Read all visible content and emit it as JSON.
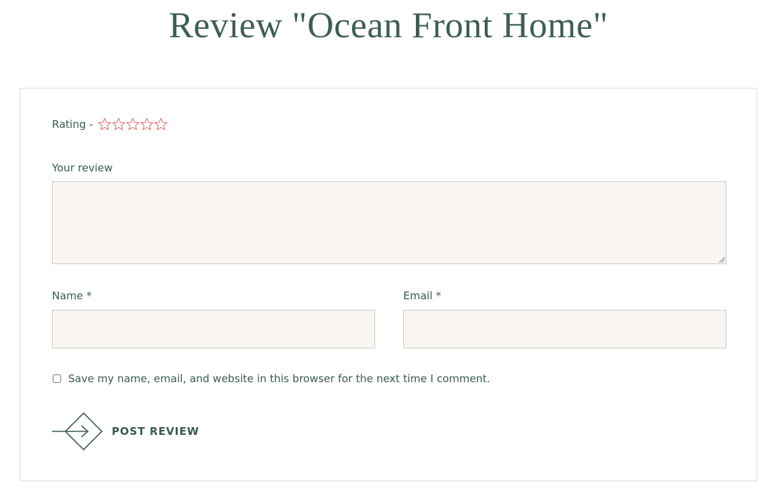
{
  "page": {
    "title": "Review \"Ocean Front Home\""
  },
  "rating": {
    "label": "Rating -",
    "max_stars": 5,
    "selected": 0,
    "star_color": "#e57373"
  },
  "review_field": {
    "label": "Your review",
    "value": ""
  },
  "name_field": {
    "label": "Name *",
    "value": ""
  },
  "email_field": {
    "label": "Email *",
    "value": ""
  },
  "save_info": {
    "label": "Save my name, email, and website in this browser for the next time I comment.",
    "checked": false
  },
  "submit": {
    "label": "POST REVIEW"
  },
  "colors": {
    "text": "#3a5a52",
    "title": "#3d5e55",
    "input_bg": "#f9f6f2",
    "input_border": "#cfcac4",
    "card_border": "#dcdcdc"
  }
}
